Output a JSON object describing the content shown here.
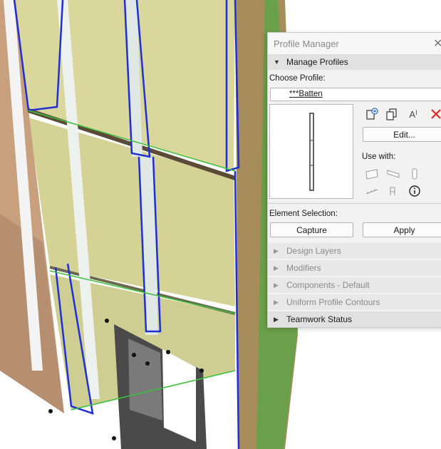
{
  "palette": {
    "title": "Profile Manager",
    "close_icon": "close-icon",
    "manage_profiles": {
      "header": "Manage Profiles",
      "choose_profile_label": "Choose Profile:",
      "selected_profile": "***Batten",
      "icons": [
        "new-profile-icon",
        "duplicate-profile-icon",
        "rename-profile-icon",
        "delete-profile-icon"
      ],
      "edit_button": "Edit...",
      "use_with_label": "Use with:",
      "use_with_icons": [
        "wall-icon",
        "beam-icon",
        "column-icon",
        "railing-icon",
        "object-icon",
        "info-icon"
      ]
    },
    "element_selection": {
      "label": "Element Selection:",
      "capture_button": "Capture",
      "apply_button": "Apply"
    },
    "sections": [
      {
        "label": "Design Layers",
        "expanded": false
      },
      {
        "label": "Modifiers",
        "expanded": false
      },
      {
        "label": "Components - Default",
        "expanded": false
      },
      {
        "label": "Uniform Profile Contours",
        "expanded": false
      },
      {
        "label": "Teamwork Status",
        "expanded": false
      }
    ]
  },
  "colors": {
    "selection_blue": "#1f2fd6",
    "edge_green": "#3bbf3b",
    "insulation": "#d8d69a",
    "cladding": "#c9a07e",
    "delete_red": "#e0281e"
  }
}
